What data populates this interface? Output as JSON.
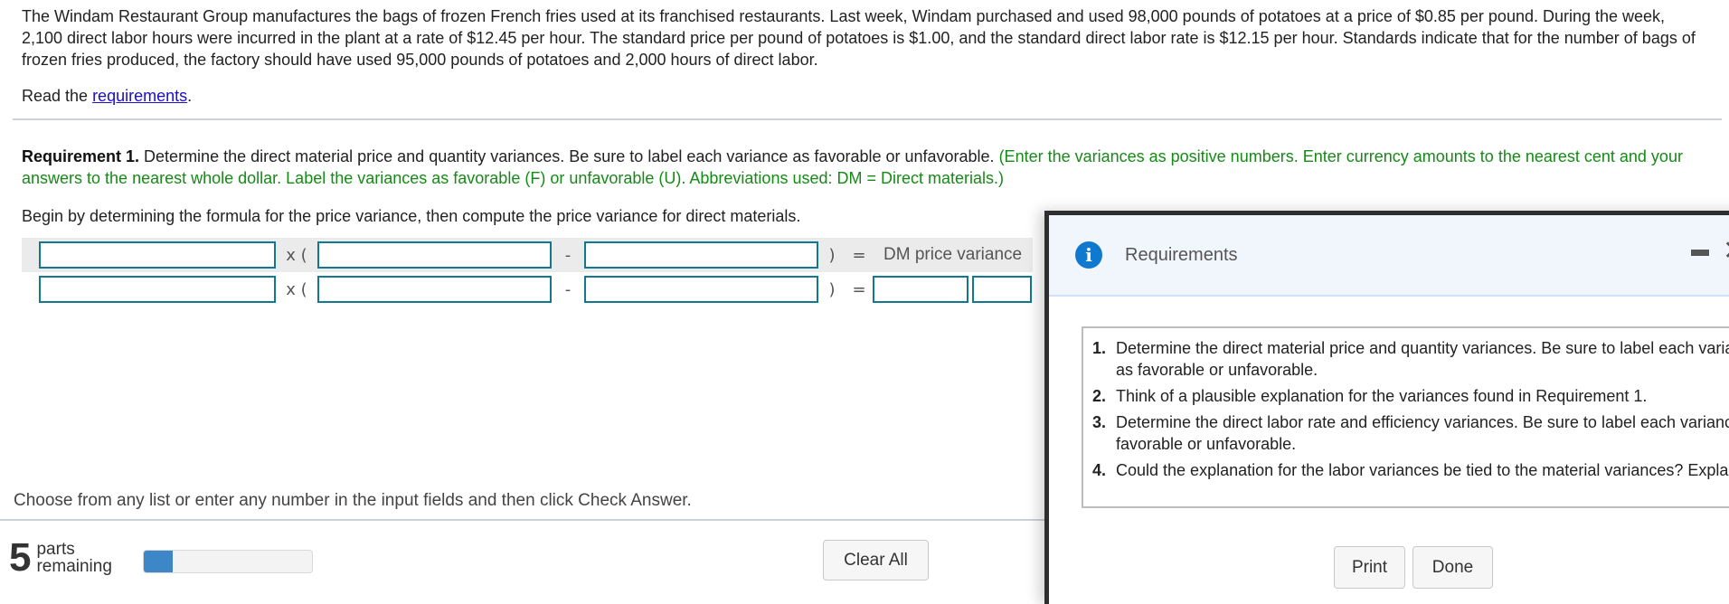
{
  "problem": {
    "text": "The Windam Restaurant Group manufactures the bags of frozen French fries used at its franchised restaurants. Last week, Windam purchased and used 98,000 pounds of potatoes at a price of $0.85 per pound. During the week, 2,100 direct labor hours were incurred in the plant at a rate of $12.45 per hour. The standard price per pound of potatoes is $1.00, and the standard direct labor rate is $12.15 per hour. Standards indicate that for the number of bags of frozen fries produced, the factory should have used 95,000 pounds of potatoes and 2,000 hours of direct labor.",
    "read_prefix": "Read the ",
    "read_link": "requirements",
    "read_suffix": "."
  },
  "requirement1": {
    "label": "Requirement 1.",
    "text": " Determine the direct material price and quantity variances. Be sure to label each variance as favorable or unfavorable. ",
    "instructions": "(Enter the variances as positive numbers. Enter currency amounts to the nearest cent and your answers to the nearest whole dollar. Label the variances as favorable (F) or unfavorable (U). Abbreviations used: DM = Direct materials.)",
    "begin": "Begin by determining the formula for the price variance, then compute the price variance for direct materials."
  },
  "formula": {
    "op_times": "x (",
    "op_minus": "-",
    "op_close": ")",
    "op_equals": "=",
    "result_label": "DM price variance",
    "row1_inputs": [
      "",
      "",
      ""
    ],
    "row2_inputs": [
      "",
      "",
      "",
      "",
      ""
    ]
  },
  "footer": {
    "choose_text": "Choose from any list or enter any number in the input fields and then click Check Answer.",
    "parts_count": "5",
    "parts_label_1": "parts",
    "parts_label_2": "remaining",
    "progress_fraction": 0.17,
    "clear_all": "Clear All"
  },
  "modal": {
    "title": "Requirements",
    "icon": "info-icon",
    "items": [
      {
        "num": "1.",
        "text": "Determine the direct material price and quantity variances. Be sure to label each variance as favorable or unfavorable."
      },
      {
        "num": "2.",
        "text": "Think of a plausible explanation for the variances found in Requirement 1."
      },
      {
        "num": "3.",
        "text": "Determine the direct labor rate and efficiency variances. Be sure to label each variance as favorable or unfavorable."
      },
      {
        "num": "4.",
        "text": "Could the explanation for the labor variances be tied to the material variances? Explain."
      }
    ],
    "print": "Print",
    "done": "Done"
  },
  "colors": {
    "input_border": "#117891",
    "instruction_green": "#168a16",
    "link_blue": "#1a0dcc",
    "progress_blue": "#3d87c9",
    "info_blue": "#0f79d0"
  }
}
